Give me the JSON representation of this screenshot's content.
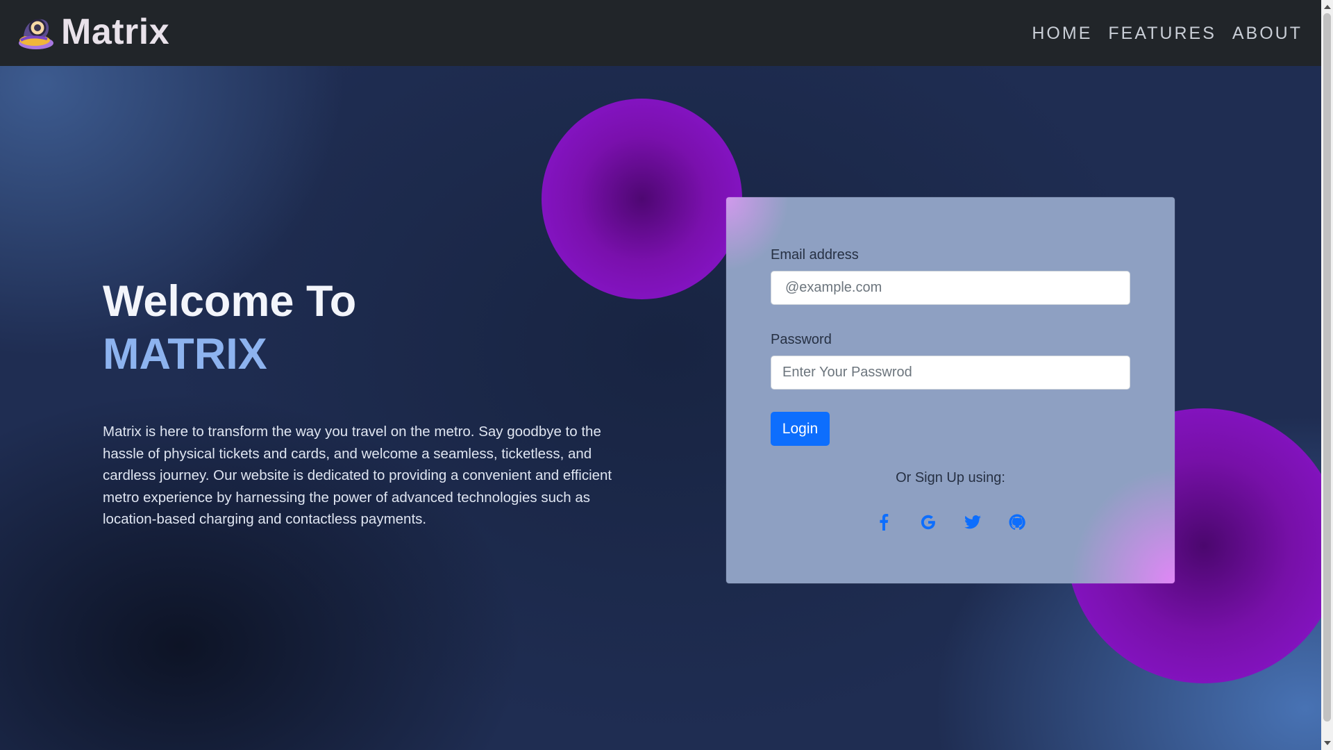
{
  "navbar": {
    "brand_name": "Matrix",
    "logo_icon": "metro-train-logo-icon",
    "links": [
      {
        "label": "HOME"
      },
      {
        "label": "FEATURES"
      },
      {
        "label": "ABOUT"
      }
    ]
  },
  "hero": {
    "title_line1": "Welcome To",
    "title_line2": "MATRIX",
    "description": "Matrix is here to transform the way you travel on the metro. Say goodbye to the hassle of physical tickets and cards, and welcome a seamless, ticketless, and cardless journey. Our website is dedicated to providing a convenient and efficient metro experience by harnessing the power of advanced technologies such as location-based charging and contactless payments."
  },
  "login_form": {
    "email_label": "Email address",
    "email_placeholder": "@example.com",
    "email_value": "",
    "password_label": "Password",
    "password_placeholder": "Enter Your Passwrod",
    "password_value": "",
    "login_button": "Login",
    "signup_text": "Or Sign Up using:",
    "social_icons": [
      "facebook-icon",
      "google-icon",
      "twitter-icon",
      "github-icon"
    ]
  },
  "colors": {
    "navbar_bg": "#212529",
    "accent_title": "#8db3ef",
    "button_primary": "#0d6efd",
    "social_icon": "#0d6efd",
    "orb_purple": "#8d17d6"
  }
}
